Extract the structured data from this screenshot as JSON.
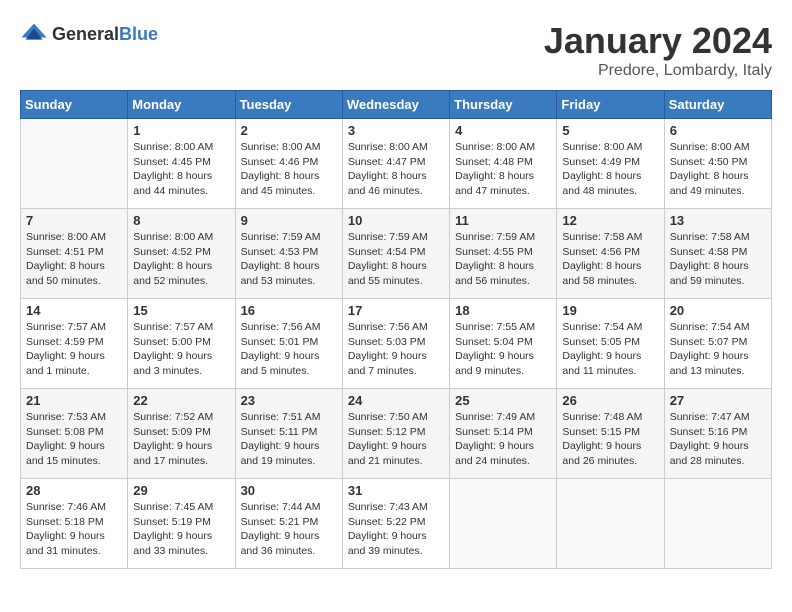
{
  "header": {
    "logo_general": "General",
    "logo_blue": "Blue",
    "month": "January 2024",
    "location": "Predore, Lombardy, Italy"
  },
  "weekdays": [
    "Sunday",
    "Monday",
    "Tuesday",
    "Wednesday",
    "Thursday",
    "Friday",
    "Saturday"
  ],
  "weeks": [
    [
      {
        "day": "",
        "sunrise": "",
        "sunset": "",
        "daylight": ""
      },
      {
        "day": "1",
        "sunrise": "Sunrise: 8:00 AM",
        "sunset": "Sunset: 4:45 PM",
        "daylight": "Daylight: 8 hours and 44 minutes."
      },
      {
        "day": "2",
        "sunrise": "Sunrise: 8:00 AM",
        "sunset": "Sunset: 4:46 PM",
        "daylight": "Daylight: 8 hours and 45 minutes."
      },
      {
        "day": "3",
        "sunrise": "Sunrise: 8:00 AM",
        "sunset": "Sunset: 4:47 PM",
        "daylight": "Daylight: 8 hours and 46 minutes."
      },
      {
        "day": "4",
        "sunrise": "Sunrise: 8:00 AM",
        "sunset": "Sunset: 4:48 PM",
        "daylight": "Daylight: 8 hours and 47 minutes."
      },
      {
        "day": "5",
        "sunrise": "Sunrise: 8:00 AM",
        "sunset": "Sunset: 4:49 PM",
        "daylight": "Daylight: 8 hours and 48 minutes."
      },
      {
        "day": "6",
        "sunrise": "Sunrise: 8:00 AM",
        "sunset": "Sunset: 4:50 PM",
        "daylight": "Daylight: 8 hours and 49 minutes."
      }
    ],
    [
      {
        "day": "7",
        "sunrise": "Sunrise: 8:00 AM",
        "sunset": "Sunset: 4:51 PM",
        "daylight": "Daylight: 8 hours and 50 minutes."
      },
      {
        "day": "8",
        "sunrise": "Sunrise: 8:00 AM",
        "sunset": "Sunset: 4:52 PM",
        "daylight": "Daylight: 8 hours and 52 minutes."
      },
      {
        "day": "9",
        "sunrise": "Sunrise: 7:59 AM",
        "sunset": "Sunset: 4:53 PM",
        "daylight": "Daylight: 8 hours and 53 minutes."
      },
      {
        "day": "10",
        "sunrise": "Sunrise: 7:59 AM",
        "sunset": "Sunset: 4:54 PM",
        "daylight": "Daylight: 8 hours and 55 minutes."
      },
      {
        "day": "11",
        "sunrise": "Sunrise: 7:59 AM",
        "sunset": "Sunset: 4:55 PM",
        "daylight": "Daylight: 8 hours and 56 minutes."
      },
      {
        "day": "12",
        "sunrise": "Sunrise: 7:58 AM",
        "sunset": "Sunset: 4:56 PM",
        "daylight": "Daylight: 8 hours and 58 minutes."
      },
      {
        "day": "13",
        "sunrise": "Sunrise: 7:58 AM",
        "sunset": "Sunset: 4:58 PM",
        "daylight": "Daylight: 8 hours and 59 minutes."
      }
    ],
    [
      {
        "day": "14",
        "sunrise": "Sunrise: 7:57 AM",
        "sunset": "Sunset: 4:59 PM",
        "daylight": "Daylight: 9 hours and 1 minute."
      },
      {
        "day": "15",
        "sunrise": "Sunrise: 7:57 AM",
        "sunset": "Sunset: 5:00 PM",
        "daylight": "Daylight: 9 hours and 3 minutes."
      },
      {
        "day": "16",
        "sunrise": "Sunrise: 7:56 AM",
        "sunset": "Sunset: 5:01 PM",
        "daylight": "Daylight: 9 hours and 5 minutes."
      },
      {
        "day": "17",
        "sunrise": "Sunrise: 7:56 AM",
        "sunset": "Sunset: 5:03 PM",
        "daylight": "Daylight: 9 hours and 7 minutes."
      },
      {
        "day": "18",
        "sunrise": "Sunrise: 7:55 AM",
        "sunset": "Sunset: 5:04 PM",
        "daylight": "Daylight: 9 hours and 9 minutes."
      },
      {
        "day": "19",
        "sunrise": "Sunrise: 7:54 AM",
        "sunset": "Sunset: 5:05 PM",
        "daylight": "Daylight: 9 hours and 11 minutes."
      },
      {
        "day": "20",
        "sunrise": "Sunrise: 7:54 AM",
        "sunset": "Sunset: 5:07 PM",
        "daylight": "Daylight: 9 hours and 13 minutes."
      }
    ],
    [
      {
        "day": "21",
        "sunrise": "Sunrise: 7:53 AM",
        "sunset": "Sunset: 5:08 PM",
        "daylight": "Daylight: 9 hours and 15 minutes."
      },
      {
        "day": "22",
        "sunrise": "Sunrise: 7:52 AM",
        "sunset": "Sunset: 5:09 PM",
        "daylight": "Daylight: 9 hours and 17 minutes."
      },
      {
        "day": "23",
        "sunrise": "Sunrise: 7:51 AM",
        "sunset": "Sunset: 5:11 PM",
        "daylight": "Daylight: 9 hours and 19 minutes."
      },
      {
        "day": "24",
        "sunrise": "Sunrise: 7:50 AM",
        "sunset": "Sunset: 5:12 PM",
        "daylight": "Daylight: 9 hours and 21 minutes."
      },
      {
        "day": "25",
        "sunrise": "Sunrise: 7:49 AM",
        "sunset": "Sunset: 5:14 PM",
        "daylight": "Daylight: 9 hours and 24 minutes."
      },
      {
        "day": "26",
        "sunrise": "Sunrise: 7:48 AM",
        "sunset": "Sunset: 5:15 PM",
        "daylight": "Daylight: 9 hours and 26 minutes."
      },
      {
        "day": "27",
        "sunrise": "Sunrise: 7:47 AM",
        "sunset": "Sunset: 5:16 PM",
        "daylight": "Daylight: 9 hours and 28 minutes."
      }
    ],
    [
      {
        "day": "28",
        "sunrise": "Sunrise: 7:46 AM",
        "sunset": "Sunset: 5:18 PM",
        "daylight": "Daylight: 9 hours and 31 minutes."
      },
      {
        "day": "29",
        "sunrise": "Sunrise: 7:45 AM",
        "sunset": "Sunset: 5:19 PM",
        "daylight": "Daylight: 9 hours and 33 minutes."
      },
      {
        "day": "30",
        "sunrise": "Sunrise: 7:44 AM",
        "sunset": "Sunset: 5:21 PM",
        "daylight": "Daylight: 9 hours and 36 minutes."
      },
      {
        "day": "31",
        "sunrise": "Sunrise: 7:43 AM",
        "sunset": "Sunset: 5:22 PM",
        "daylight": "Daylight: 9 hours and 39 minutes."
      },
      {
        "day": "",
        "sunrise": "",
        "sunset": "",
        "daylight": ""
      },
      {
        "day": "",
        "sunrise": "",
        "sunset": "",
        "daylight": ""
      },
      {
        "day": "",
        "sunrise": "",
        "sunset": "",
        "daylight": ""
      }
    ]
  ]
}
